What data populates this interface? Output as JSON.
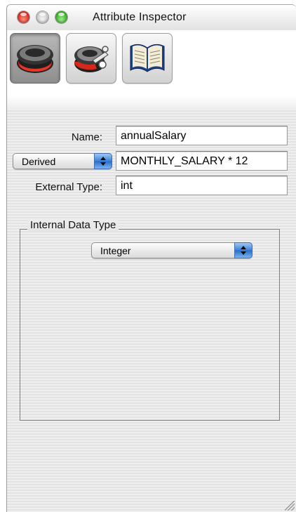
{
  "window": {
    "title": "Attribute Inspector"
  },
  "toolbar": {
    "buttons": [
      {
        "icon": "attribute-inspector-icon",
        "selected": true
      },
      {
        "icon": "advanced-attribute-icon",
        "selected": false
      },
      {
        "icon": "book-icon",
        "selected": false
      }
    ]
  },
  "form": {
    "name_label": "Name:",
    "name_value": "annualSalary",
    "mode_popup_value": "Derived",
    "derived_value": "MONTHLY_SALARY * 12",
    "external_type_label": "External Type:",
    "external_type_value": "int"
  },
  "internal_data_type": {
    "group_title": "Internal Data Type",
    "selected": "Integer"
  },
  "colors": {
    "accent_blue": "#3a7fd8",
    "close_red": "#d1251a",
    "zoom_green": "#2fa81d"
  }
}
